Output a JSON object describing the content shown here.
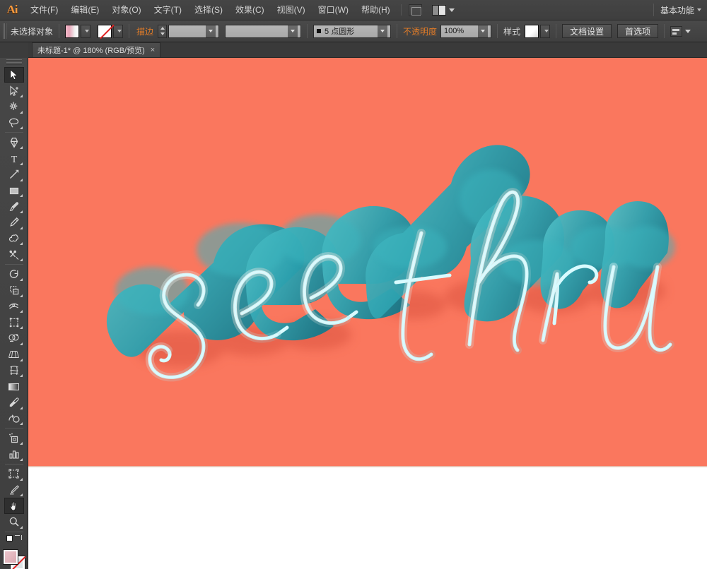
{
  "app": {
    "name": "Adobe Illustrator",
    "logo_text": "Ai"
  },
  "menubar": {
    "items": [
      {
        "label": "文件(F)",
        "name": "menu-file"
      },
      {
        "label": "编辑(E)",
        "name": "menu-edit"
      },
      {
        "label": "对象(O)",
        "name": "menu-object"
      },
      {
        "label": "文字(T)",
        "name": "menu-type"
      },
      {
        "label": "选择(S)",
        "name": "menu-select"
      },
      {
        "label": "效果(C)",
        "name": "menu-effect"
      },
      {
        "label": "视图(V)",
        "name": "menu-view"
      },
      {
        "label": "窗口(W)",
        "name": "menu-window"
      },
      {
        "label": "帮助(H)",
        "name": "menu-help"
      }
    ],
    "workspace_label": "基本功能"
  },
  "controlbar": {
    "selection_status": "未选择对象",
    "fill_label": "填色",
    "stroke_label": "描边",
    "stroke_weight": "",
    "stroke_profile": "",
    "brush_definition": "5 点圆形",
    "opacity_label": "不透明度",
    "opacity_value": "100%",
    "style_label": "样式",
    "document_setup_label": "文档设置",
    "preferences_label": "首选项"
  },
  "document": {
    "tab_title": "未标题-1* @ 180% (RGB/预览)",
    "close_glyph": "×",
    "zoom": "180%",
    "color_mode": "RGB",
    "view_mode": "预览"
  },
  "toolbar": {
    "tools": [
      {
        "name": "selection-tool",
        "title": "选择工具"
      },
      {
        "name": "direct-selection-tool",
        "title": "直接选择工具"
      },
      {
        "name": "magic-wand-tool",
        "title": "魔棒工具"
      },
      {
        "name": "lasso-tool",
        "title": "套索工具"
      },
      {
        "name": "pen-tool",
        "title": "钢笔工具"
      },
      {
        "name": "type-tool",
        "title": "文字工具"
      },
      {
        "name": "line-segment-tool",
        "title": "直线段工具"
      },
      {
        "name": "rectangle-tool",
        "title": "矩形工具"
      },
      {
        "name": "paintbrush-tool",
        "title": "画笔工具"
      },
      {
        "name": "pencil-tool",
        "title": "铅笔工具"
      },
      {
        "name": "blob-brush-tool",
        "title": "斑点画笔工具"
      },
      {
        "name": "eraser-tool",
        "title": "橡皮擦工具"
      },
      {
        "name": "rotate-tool",
        "title": "旋转工具"
      },
      {
        "name": "scale-tool",
        "title": "比例缩放工具"
      },
      {
        "name": "width-tool",
        "title": "宽度工具"
      },
      {
        "name": "free-transform-tool",
        "title": "自由变换工具"
      },
      {
        "name": "shape-builder-tool",
        "title": "形状生成器工具"
      },
      {
        "name": "perspective-grid-tool",
        "title": "透视网格工具"
      },
      {
        "name": "mesh-tool",
        "title": "网格工具"
      },
      {
        "name": "gradient-tool",
        "title": "渐变工具"
      },
      {
        "name": "eyedropper-tool",
        "title": "吸管工具"
      },
      {
        "name": "blend-tool",
        "title": "混合工具"
      },
      {
        "name": "symbol-sprayer-tool",
        "title": "符号喷枪工具"
      },
      {
        "name": "column-graph-tool",
        "title": "柱形图工具"
      },
      {
        "name": "artboard-tool",
        "title": "画板工具"
      },
      {
        "name": "slice-tool",
        "title": "切片工具"
      },
      {
        "name": "hand-tool",
        "title": "抓手工具",
        "active": true
      },
      {
        "name": "zoom-tool",
        "title": "缩放工具"
      }
    ]
  },
  "artwork": {
    "text_line_1": "see",
    "text_line_2": "thru",
    "full_text": "see thru",
    "background_color": "#fa775e",
    "face_color_light": "#3fb4bd",
    "face_color_dark": "#12707f",
    "extrude_color": "#1d8d9a",
    "outline_color": "#d9fbff",
    "shadow_color": "#e8604a",
    "style": "3D extruded script lettering"
  },
  "colors": {
    "chrome_dark": "#3c3c3c",
    "chrome_mid": "#4a4a4a",
    "accent_orange": "#e07b28",
    "canvas_white": "#ffffff"
  }
}
